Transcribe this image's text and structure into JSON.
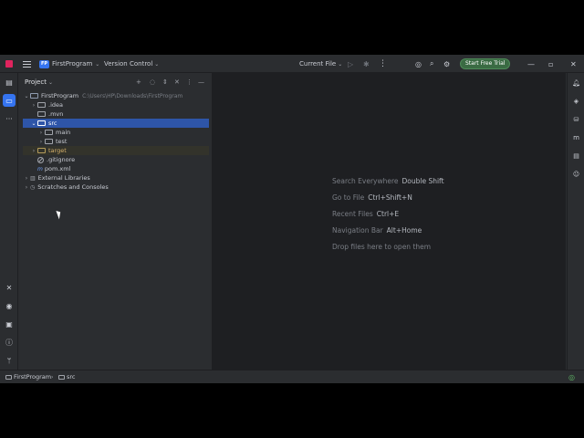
{
  "titlebar": {
    "project_badge": "FP",
    "project_name": "FirstProgram",
    "vcs_label": "Version Control",
    "run_config": "Current File",
    "trial_button": "Start Free Trial"
  },
  "project_panel": {
    "title": "Project",
    "tree": [
      {
        "label": "FirstProgram",
        "hint": "C:\\Users\\HP\\Downloads\\FirstProgram"
      },
      {
        "label": ".idea"
      },
      {
        "label": ".mvn"
      },
      {
        "label": "src"
      },
      {
        "label": "main"
      },
      {
        "label": "test"
      },
      {
        "label": "target"
      },
      {
        "label": ".gitignore"
      },
      {
        "label": "pom.xml"
      },
      {
        "label": "External Libraries"
      },
      {
        "label": "Scratches and Consoles"
      }
    ]
  },
  "editor_hints": [
    {
      "label": "Search Everywhere",
      "key": "Double Shift"
    },
    {
      "label": "Go to File",
      "key": "Ctrl+Shift+N"
    },
    {
      "label": "Recent Files",
      "key": "Ctrl+E"
    },
    {
      "label": "Navigation Bar",
      "key": "Alt+Home"
    },
    {
      "label": "Drop files here to open them",
      "key": ""
    }
  ],
  "statusbar": {
    "breadcrumb_project": "FirstProgram",
    "breadcrumb_folder": "src"
  },
  "icons": {
    "app": "intellij-logo-icon",
    "menu": "hamburger-menu-icon",
    "run": "run-icon",
    "debug": "debug-icon"
  },
  "colors": {
    "selection": "#2e55a8",
    "accent": "#3574f0",
    "trial": "#3a6b43",
    "editor_bg": "#1e1f22",
    "panel_bg": "#2b2d30"
  }
}
